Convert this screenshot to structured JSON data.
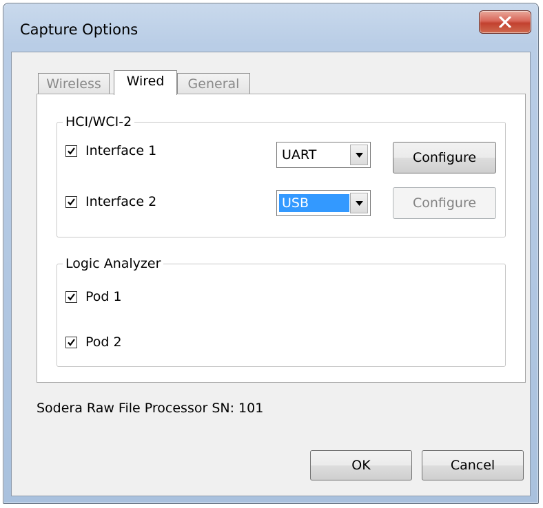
{
  "window": {
    "title": "Capture Options",
    "close_label": "X"
  },
  "tabs": [
    {
      "label": "Wireless",
      "active": false
    },
    {
      "label": "Wired",
      "active": true
    },
    {
      "label": "General",
      "active": false
    }
  ],
  "hci_group": {
    "title": "HCI/WCI-2",
    "interface1": {
      "label": "Interface 1",
      "checked": true,
      "combo_value": "UART",
      "configure_label": "Configure",
      "configure_enabled": true
    },
    "interface2": {
      "label": "Interface 2",
      "checked": true,
      "combo_value": "USB",
      "configure_label": "Configure",
      "configure_enabled": false
    }
  },
  "logic_group": {
    "title": "Logic Analyzer",
    "pod1": {
      "label": "Pod 1",
      "checked": true
    },
    "pod2": {
      "label": "Pod 2",
      "checked": true
    }
  },
  "status_text": "Sodera Raw File Processor SN: 101",
  "footer": {
    "ok_label": "OK",
    "cancel_label": "Cancel"
  },
  "colors": {
    "selection": "#3399ff",
    "close_button": "#c2412f",
    "frame": "#b9cde6"
  }
}
